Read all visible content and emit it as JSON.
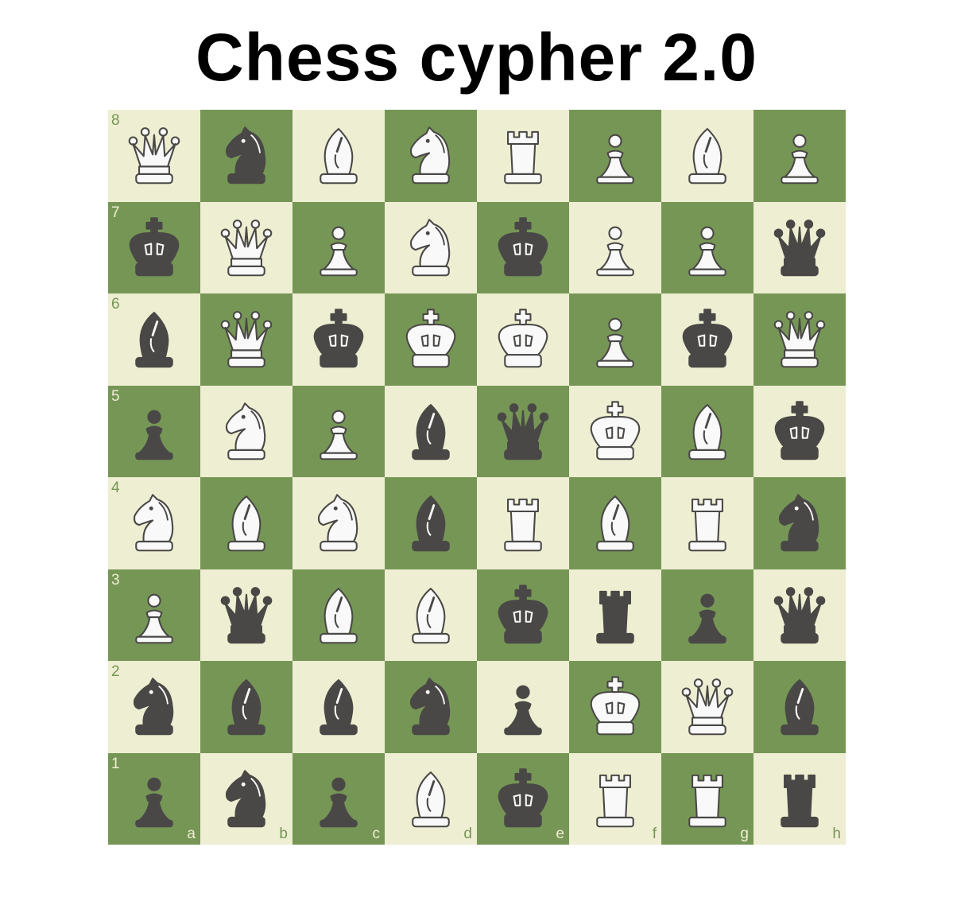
{
  "title": "Chess cypher 2.0",
  "colors": {
    "light": "#eeeed2",
    "dark": "#769656",
    "white_piece": "#f9f9f9",
    "black_piece": "#4a4846",
    "outline": "#4a4846"
  },
  "files": [
    "a",
    "b",
    "c",
    "d",
    "e",
    "f",
    "g",
    "h"
  ],
  "ranks": [
    "8",
    "7",
    "6",
    "5",
    "4",
    "3",
    "2",
    "1"
  ],
  "board": [
    [
      "wq",
      "bn",
      "wb",
      "wn",
      "wr",
      "wp",
      "wb",
      "wp"
    ],
    [
      "bk",
      "wq",
      "wp",
      "wn",
      "bk",
      "wp",
      "wp",
      "bq"
    ],
    [
      "bb",
      "wq",
      "bk",
      "wk",
      "wk",
      "wp",
      "bk",
      "wq"
    ],
    [
      "bp",
      "wn",
      "wp",
      "bb",
      "bq",
      "wk",
      "wb",
      "bk"
    ],
    [
      "wn",
      "wb",
      "wn",
      "bb",
      "wr",
      "wb",
      "wr",
      "bn"
    ],
    [
      "wp",
      "bq",
      "wb",
      "wb",
      "bk",
      "br",
      "bp",
      "bq"
    ],
    [
      "bn",
      "bb",
      "bb",
      "bn",
      "bp",
      "wk",
      "wq",
      "bb"
    ],
    [
      "bp",
      "bn",
      "bp",
      "wb",
      "bk",
      "wr",
      "wr",
      "br"
    ]
  ],
  "piece_names": {
    "k": "king",
    "q": "queen",
    "r": "rook",
    "b": "bishop",
    "n": "knight",
    "p": "pawn"
  }
}
